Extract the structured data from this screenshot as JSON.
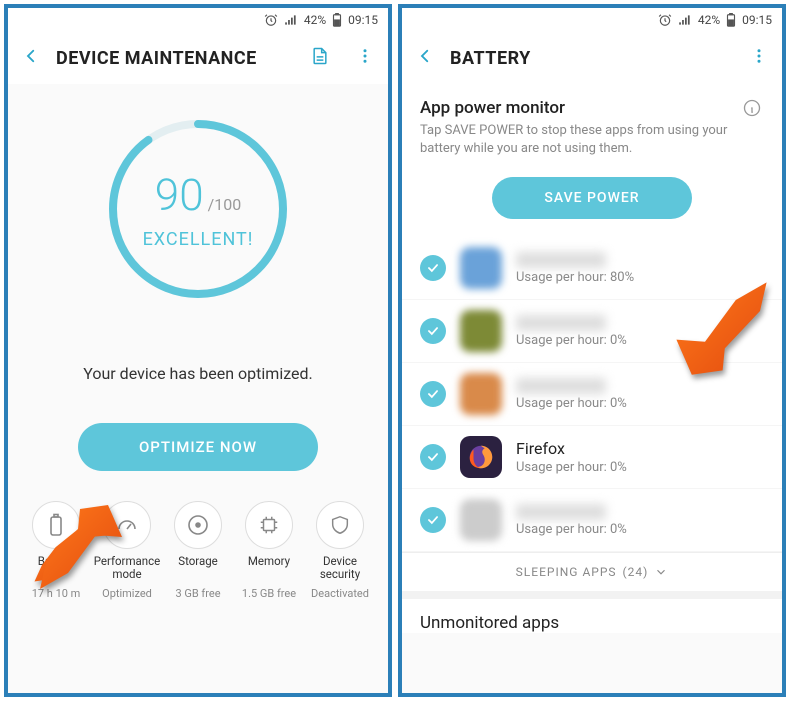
{
  "status": {
    "battery_pct": "42%",
    "time": "09:15"
  },
  "left": {
    "title": "DEVICE MAINTENANCE",
    "score": "90",
    "score_of": "/100",
    "score_label": "EXCELLENT!",
    "optimized_msg": "Your device has been optimized.",
    "optimize_btn": "OPTIMIZE NOW",
    "chips": [
      {
        "name": "Battery",
        "sub": "17 h 10 m"
      },
      {
        "name": "Performance mode",
        "sub": "Optimized"
      },
      {
        "name": "Storage",
        "sub": "3 GB free"
      },
      {
        "name": "Memory",
        "sub": "1.5 GB free"
      },
      {
        "name": "Device security",
        "sub": "Deactivated"
      }
    ]
  },
  "right": {
    "title": "BATTERY",
    "section_title": "App power monitor",
    "section_desc": "Tap SAVE POWER to stop these apps from using your battery while you are not using them.",
    "save_btn": "SAVE POWER",
    "apps": [
      {
        "name": "",
        "usage": "Usage per hour: 80%",
        "blurred": true,
        "iconColor": "#6aa2d9"
      },
      {
        "name": "",
        "usage": "Usage per hour: 0%",
        "blurred": true,
        "iconColor": "#7d8a36"
      },
      {
        "name": "",
        "usage": "Usage per hour: 0%",
        "blurred": true,
        "iconColor": "#d98a4a"
      },
      {
        "name": "Firefox",
        "usage": "Usage per hour: 0%",
        "blurred": false,
        "iconColor": "#2b2140"
      },
      {
        "name": "",
        "usage": "Usage per hour: 0%",
        "blurred": true,
        "iconColor": "#cccccc"
      }
    ],
    "sleeping_label": "SLEEPING APPS",
    "sleeping_count": "(24)",
    "unmonitored": "Unmonitored apps"
  }
}
